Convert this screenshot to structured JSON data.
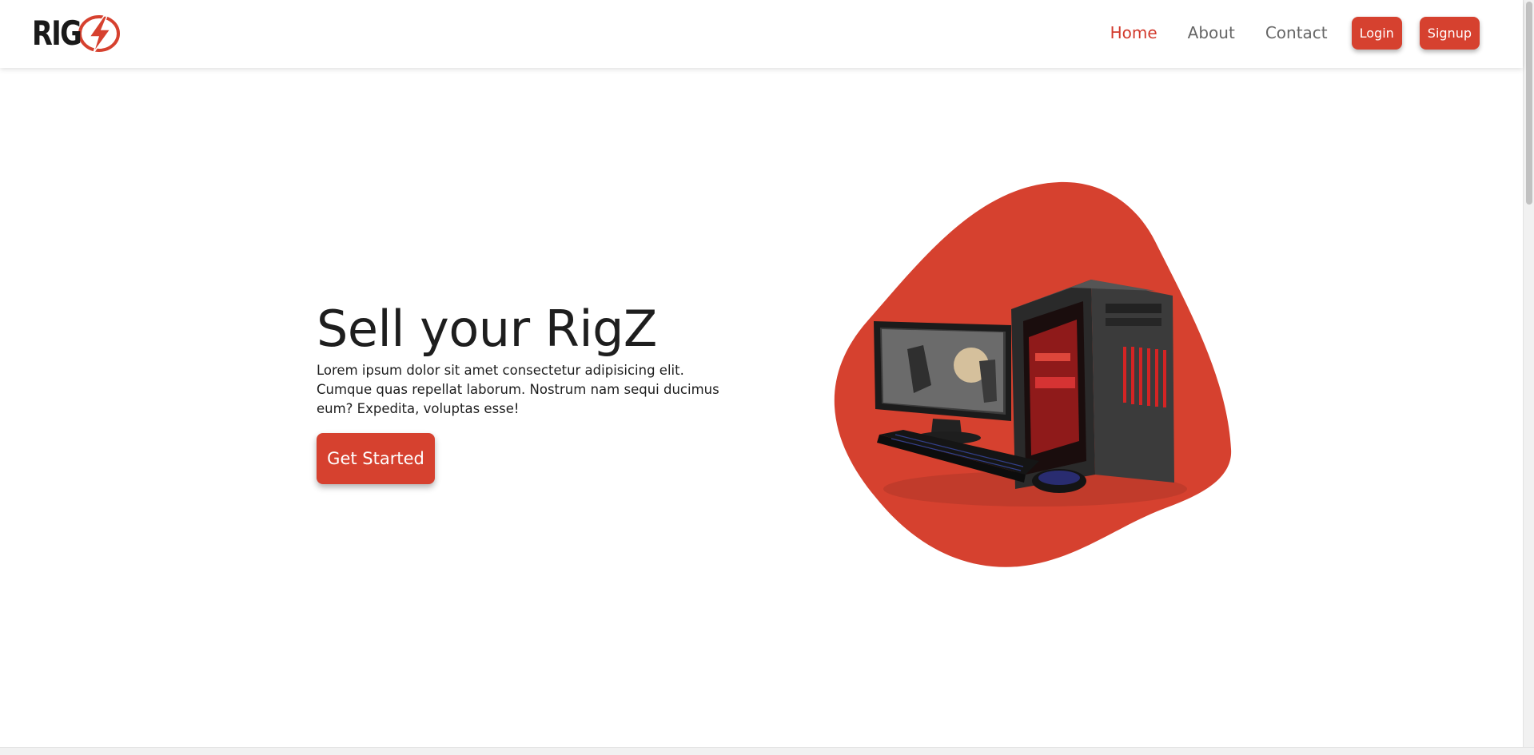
{
  "brand": {
    "logo_text": "RIG"
  },
  "nav": {
    "links": [
      {
        "label": "Home",
        "active": true
      },
      {
        "label": "About",
        "active": false
      },
      {
        "label": "Contact",
        "active": false
      }
    ],
    "login_label": "Login",
    "signup_label": "Signup"
  },
  "hero": {
    "title": "Sell your RigZ",
    "description": "Lorem ipsum dolor sit amet consectetur adipisicing elit. Cumque quas repellat laborum. Nostrum nam sequi ducimus eum? Expedita, voluptas esse!",
    "cta_label": "Get Started"
  },
  "colors": {
    "accent": "#d6412f",
    "active_link": "#d23a2c",
    "text": "#1e1e1e",
    "muted": "#666666"
  },
  "icons": {
    "logo": "lightning-bolt-icon",
    "hero_image": "gaming-pc-illustration"
  }
}
